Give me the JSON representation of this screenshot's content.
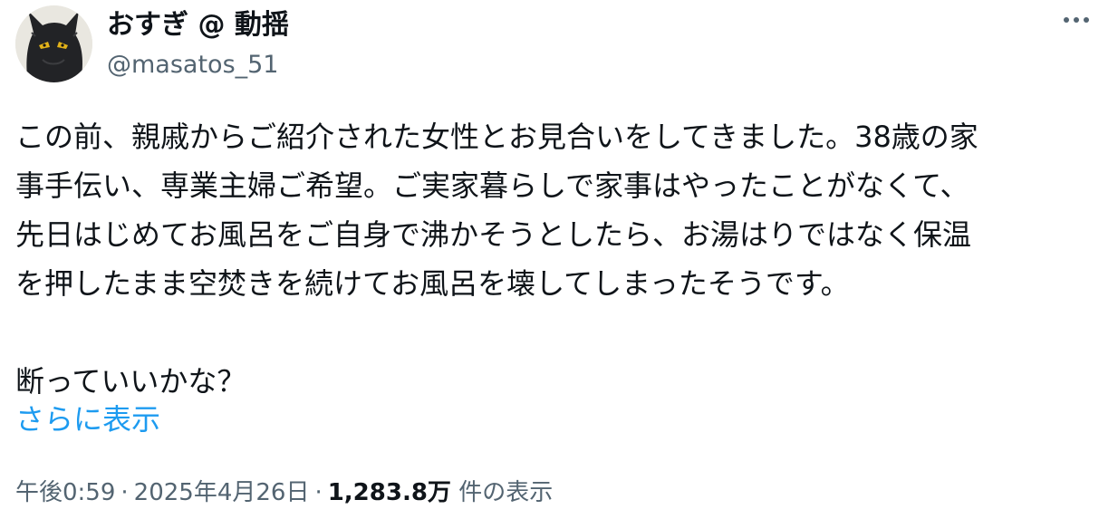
{
  "author": {
    "display_name": "おすぎ @ 動揺",
    "handle": "@masatos_51",
    "avatar_icon": "black-cat-avatar"
  },
  "menu": {
    "icon": "more-options-icon"
  },
  "tweet": {
    "text": "この前、親戚からご紹介された女性とお見合いをしてきました。38歳の家\n事手伝い、専業主婦ご希望。ご実家暮らしで家事はやったことがなくて、\n先日はじめてお風呂をご自身で沸かそうとしたら、お湯はりではなく保温\nを押したまま空焚きを続けてお風呂を壊してしまったそうです。\n\n断っていいかな？",
    "show_more": "さらに表示"
  },
  "meta": {
    "time": "午後0:59",
    "separator": "·",
    "date": "2025年4月26日",
    "views_count": "1,283.8万",
    "views_label": "件の表示"
  },
  "colors": {
    "link": "#1d9bf0",
    "secondary_text": "#536471",
    "primary_text": "#0f1419"
  }
}
